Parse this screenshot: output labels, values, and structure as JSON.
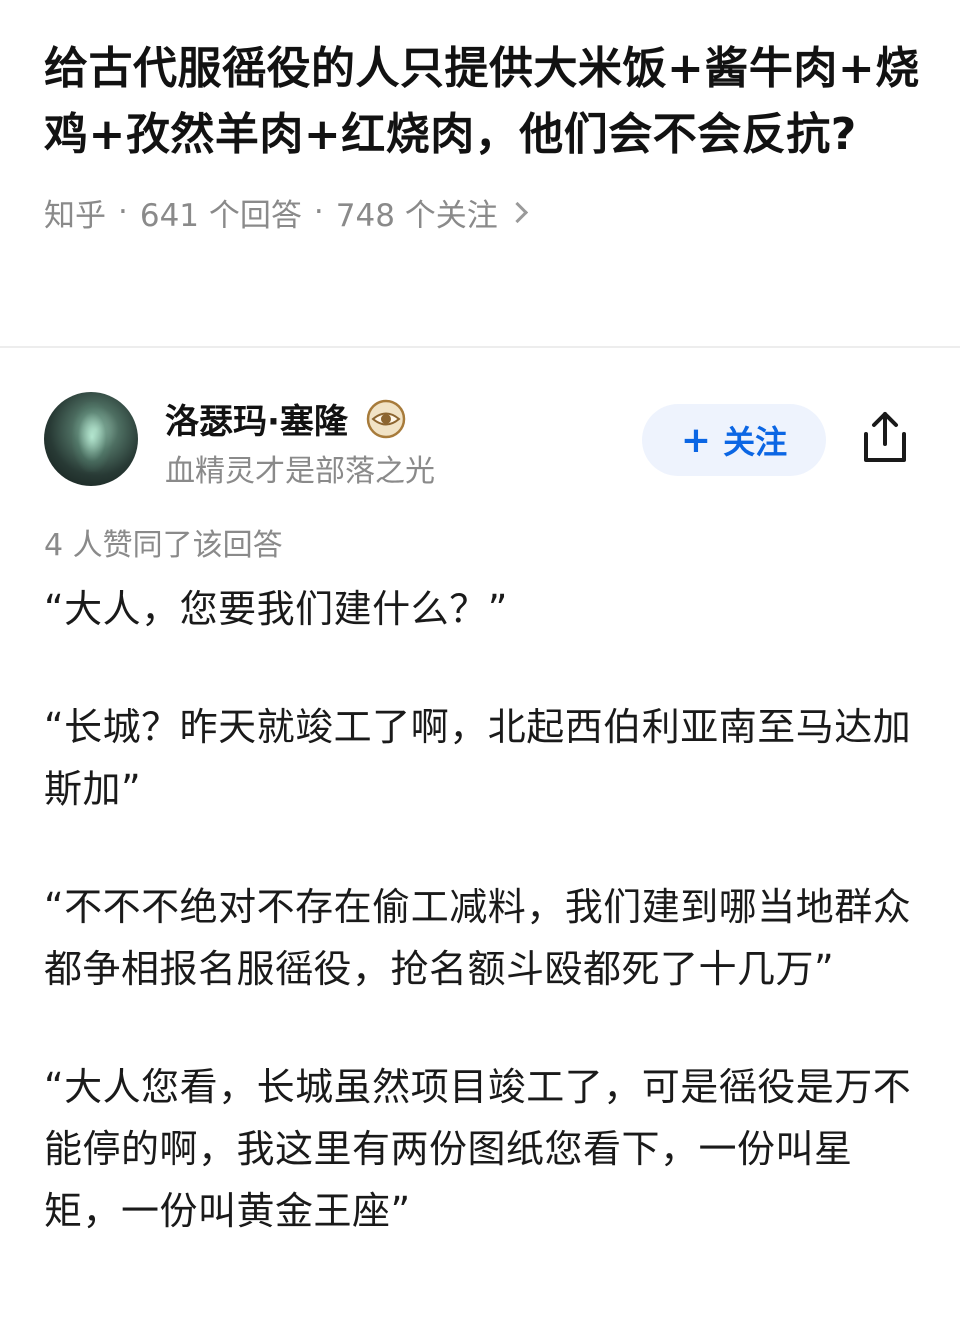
{
  "question": {
    "title": "给古代服徭役的人只提供大米饭+酱牛肉+烧鸡+孜然羊肉+红烧肉，他们会不会反抗?",
    "source": "知乎",
    "answers_count": "641 个回答",
    "followers_count": "748 个关注"
  },
  "author": {
    "name": "洛瑟玛·塞隆",
    "bio": "血精灵才是部落之光",
    "badge_icon": "eye-badge-icon",
    "follow_label": "关注",
    "follow_plus": "+"
  },
  "answer": {
    "likes": "4 人赞同了该回答",
    "paragraphs": [
      "“大人，您要我们建什么？”",
      "“长城？昨天就竣工了啊，北起西伯利亚南至马达加斯加”",
      "“不不不绝对不存在偷工减料，我们建到哪当地群众都争相报名服徭役，抢名额斗殴都死了十几万”",
      "“大人您看，长城虽然项目竣工了，可是徭役是万不能停的啊，我这里有两份图纸您看下，一份叫星矩，一份叫黄金王座”"
    ]
  },
  "colors": {
    "accent": "#0b66e4",
    "follow_bg": "#eef3fd",
    "meta_text": "#8a8a8a"
  }
}
